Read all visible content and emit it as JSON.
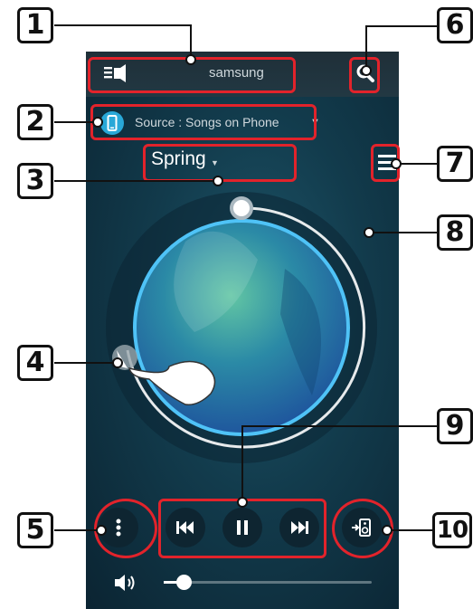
{
  "header": {
    "device_name": "samsung",
    "tv_icon": "tv-speaker-icon",
    "search_icon": "search-icon"
  },
  "source": {
    "label": "Source : Songs on Phone",
    "icon": "phone-icon"
  },
  "playlist": {
    "name": "Spring"
  },
  "controls": {
    "more_icon": "more-vertical-icon",
    "prev_icon": "skip-previous-icon",
    "pause_icon": "pause-icon",
    "next_icon": "skip-next-icon",
    "output_icon": "speaker-output-icon",
    "volume_icon": "volume-icon",
    "menu_icon": "menu-icon"
  },
  "progress": {
    "fraction": 0.32
  },
  "volume": {
    "fraction": 0.1
  },
  "callouts": [
    "1",
    "2",
    "3",
    "4",
    "5",
    "6",
    "7",
    "8",
    "9",
    "10"
  ],
  "colors": {
    "callout_red": "#e2232b",
    "ring_blue": "#4fc3f7",
    "background": "#123b4c"
  }
}
